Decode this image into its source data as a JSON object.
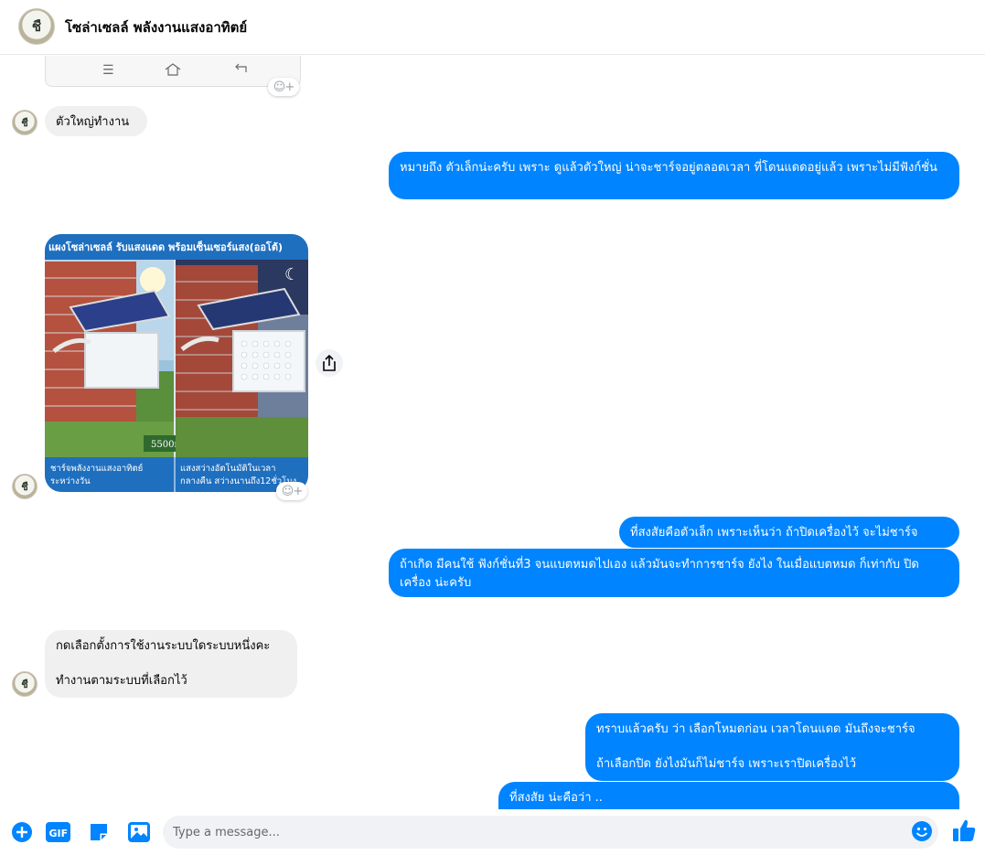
{
  "header": {
    "contact_name": "โซล่าเซลล์ พลังงานแสงอาทิตย์",
    "avatar_glyph": "ชื"
  },
  "thread": {
    "messages": [
      {
        "side": "in",
        "text": "ตัวใหญ่ทำงาน"
      },
      {
        "side": "out",
        "text": "หมายถึง ตัวเล็กน่ะครับ  เพราะ ดูแล้วตัวใหญ่ น่าจะชาร์จอยู่ตลอดเวลา ที่โดนแดดอยู่แล้ว เพราะไม่มีฟังก์ชั่น"
      },
      {
        "side": "in",
        "type": "image"
      },
      {
        "side": "out",
        "text": "ที่สงสัยคือตัวเล็ก  เพราะเห็นว่า  ถ้าปิดเครื่องไว้ จะไม่ชาร์จ"
      },
      {
        "side": "out",
        "text": "ถ้าเกิด มีคนใช้ ฟังก์ชั่นที่3 จนแบตหมดไปเอง  แล้วมันจะทำการชาร์จ ยังไง  ในเมื่อแบตหมด ก็เท่ากับ ปิดเครื่อง  น่ะครับ"
      },
      {
        "side": "in",
        "line1": "กดเลือกตั้งการใช้งานระบบใดระบบหนึ่งคะ",
        "line2": "ทำงานตามระบบที่เลือกไว้"
      },
      {
        "side": "out",
        "line1": "ทราบแล้วครับ ว่า เลือกโหมดก่อน  เวลาโดนแดด มันถึงจะชาร์จ",
        "line2": "ถ้าเลือกปิด  ยังไงมันก็ไม่ชาร์จ  เพราะเราปิดเครื่องไว้"
      },
      {
        "side": "out",
        "text": "ที่สงสัย น่ะคือว่า .."
      }
    ],
    "image": {
      "banner": "แผงโซล่าเซลล์ รับแสงแดด พร้อมเซ็นเซอร์แสง(ออโต้)",
      "battery_label": "5500mAh",
      "caption_left_1": "ชาร์จพลังงานแสงอาทิตย์",
      "caption_left_2": "ระหว่างวัน",
      "caption_right_1": "แสงสว่างอัตโนมัติในเวลา",
      "caption_right_2": "กลางคืน สว่างนานถึง12ชั่วโมง"
    }
  },
  "composer": {
    "placeholder": "Type a message...",
    "gif_label": "GIF"
  },
  "colors": {
    "outgoing_bubble": "#0084ff",
    "incoming_bubble": "#f0f0f0",
    "accent": "#0084ff"
  },
  "icons": [
    "plus-circle-icon",
    "gif-icon",
    "sticker-icon",
    "image-icon",
    "emoji-icon",
    "thumbs-up-icon",
    "share-icon",
    "add-reaction-icon",
    "menu-icon",
    "home-icon",
    "back-icon"
  ]
}
